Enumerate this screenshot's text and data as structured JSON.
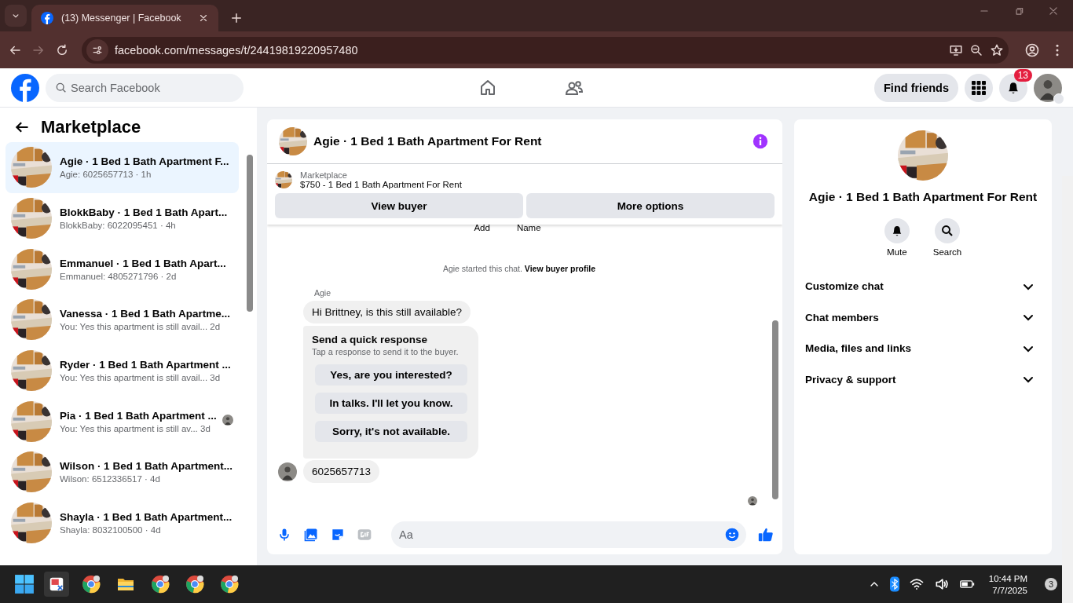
{
  "browser": {
    "tabs": [
      {
        "title": "(13) Messenger | Facebook",
        "selected": true
      }
    ],
    "url": "facebook.com/messages/t/24419819220957480"
  },
  "header": {
    "search_placeholder": "Search Facebook",
    "find_friends": "Find friends",
    "notification_count": "13"
  },
  "sidebar": {
    "title": "Marketplace",
    "conversations": [
      {
        "title": "Agie · 1 Bed 1 Bath Apartment F...",
        "subtitle": "Agie: 6025657713 · 1h",
        "selected": true,
        "read_receipt": false
      },
      {
        "title": "BlokkBaby · 1 Bed 1 Bath Apart...",
        "subtitle": "BlokkBaby: 6022095451 · 4h",
        "selected": false,
        "read_receipt": false
      },
      {
        "title": "Emmanuel · 1 Bed 1 Bath Apart...",
        "subtitle": "Emmanuel: 4805271796 · 2d",
        "selected": false,
        "read_receipt": false
      },
      {
        "title": "Vanessa · 1 Bed 1 Bath Apartme...",
        "subtitle": "You: Yes this apartment is still avail... 2d",
        "selected": false,
        "read_receipt": false
      },
      {
        "title": "Ryder · 1 Bed 1 Bath Apartment ...",
        "subtitle": "You: Yes this apartment is still avail... 3d",
        "selected": false,
        "read_receipt": false
      },
      {
        "title": "Pia · 1 Bed 1 Bath Apartment ...",
        "subtitle": "You: Yes this apartment is still av... 3d",
        "selected": false,
        "read_receipt": true
      },
      {
        "title": "Wilson · 1 Bed 1 Bath Apartment...",
        "subtitle": "Wilson: 6512336517 · 4d",
        "selected": false,
        "read_receipt": false
      },
      {
        "title": "Shayla · 1 Bed 1 Bath Apartment...",
        "subtitle": "Shayla: 8032100500 · 4d",
        "selected": false,
        "read_receipt": false
      }
    ]
  },
  "chat": {
    "title": "Agie · 1 Bed 1 Bath Apartment For Rent",
    "listing": {
      "label": "Marketplace",
      "title": "$750 - 1 Bed 1 Bath Apartment For Rent"
    },
    "buttons": [
      "View buyer",
      "More options"
    ],
    "cut_labels": [
      "Add",
      "Name"
    ],
    "system_note": "Agie started this chat.",
    "system_link": "View buyer profile",
    "sender": "Agie",
    "first_message": "Hi Brittney, is this still available?",
    "quick_response": {
      "title": "Send a quick response",
      "subtitle": "Tap a response to send it to the buyer.",
      "options": [
        "Yes, are you interested?",
        "In talks. I'll let you know.",
        "Sorry, it's not available."
      ]
    },
    "last_message": "6025657713",
    "composer_placeholder": "Aa"
  },
  "details": {
    "title": "Agie · 1 Bed 1 Bath Apartment For Rent",
    "actions": [
      {
        "kind": "mute",
        "label": "Mute"
      },
      {
        "kind": "search",
        "label": "Search"
      }
    ],
    "sections": [
      {
        "label": "Customize chat",
        "expanded": false
      },
      {
        "label": "Chat members",
        "expanded": false
      },
      {
        "label": "Media, files and links",
        "expanded": false
      },
      {
        "label": "Privacy & support",
        "expanded": false
      }
    ]
  },
  "taskbar": {
    "time": "10:44 PM",
    "date": "7/7/2025",
    "notification_count": "3"
  }
}
